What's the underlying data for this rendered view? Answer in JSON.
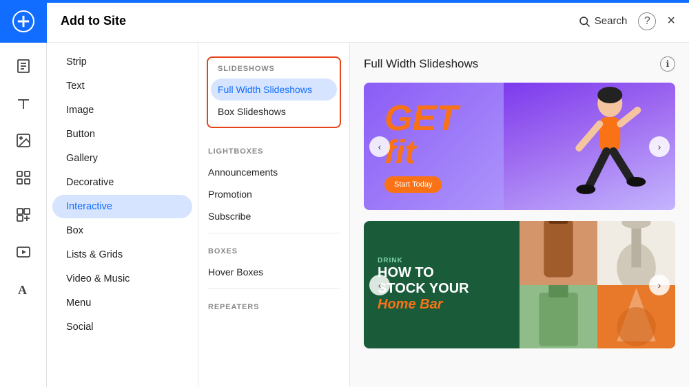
{
  "app": {
    "title": "Add to Site",
    "top_bar_color": "#116dff"
  },
  "header": {
    "title": "Add to Site",
    "search_label": "Search",
    "help_label": "?",
    "close_label": "×"
  },
  "left_nav": {
    "items": [
      {
        "id": "strip",
        "label": "Strip"
      },
      {
        "id": "text",
        "label": "Text"
      },
      {
        "id": "image",
        "label": "Image"
      },
      {
        "id": "button",
        "label": "Button"
      },
      {
        "id": "gallery",
        "label": "Gallery"
      },
      {
        "id": "decorative",
        "label": "Decorative"
      },
      {
        "id": "interactive",
        "label": "Interactive",
        "active": true
      },
      {
        "id": "box",
        "label": "Box"
      },
      {
        "id": "lists-grids",
        "label": "Lists & Grids"
      },
      {
        "id": "video-music",
        "label": "Video & Music"
      },
      {
        "id": "menu",
        "label": "Menu"
      },
      {
        "id": "social",
        "label": "Social"
      }
    ]
  },
  "middle_nav": {
    "sections": [
      {
        "id": "slideshows",
        "label": "SLIDESHOWS",
        "boxed": true,
        "items": [
          {
            "id": "full-width",
            "label": "Full Width Slideshows",
            "active": true
          },
          {
            "id": "box-slideshows",
            "label": "Box Slideshows"
          }
        ]
      },
      {
        "id": "lightboxes",
        "label": "LIGHTBOXES",
        "boxed": false,
        "items": [
          {
            "id": "announcements",
            "label": "Announcements"
          },
          {
            "id": "promotion",
            "label": "Promotion"
          },
          {
            "id": "subscribe",
            "label": "Subscribe"
          }
        ]
      },
      {
        "id": "boxes",
        "label": "BOXES",
        "boxed": false,
        "items": [
          {
            "id": "hover-boxes",
            "label": "Hover Boxes"
          }
        ]
      },
      {
        "id": "repeaters",
        "label": "REPEATERS",
        "boxed": false,
        "items": []
      }
    ]
  },
  "right_panel": {
    "title": "Full Width Slideshows",
    "info_tooltip": "Information",
    "cards": [
      {
        "id": "fitness-card",
        "type": "fitness",
        "heading1": "GET",
        "heading2": "fit",
        "cta": "Start Today"
      },
      {
        "id": "bar-card",
        "type": "bar",
        "drink_label": "DRINK",
        "line1": "HOW TO",
        "line2": "STOCK YOUR",
        "line3": "Home Bar"
      }
    ]
  },
  "icons": {
    "plus": "+",
    "page": "▣",
    "text_icon": "A",
    "image_icon": "⛰",
    "gallery_icon": "⊞",
    "app_icon": "✦",
    "video_icon": "▶",
    "font_icon": "A",
    "search": "🔍",
    "arrow_left": "‹",
    "arrow_right": "›"
  }
}
